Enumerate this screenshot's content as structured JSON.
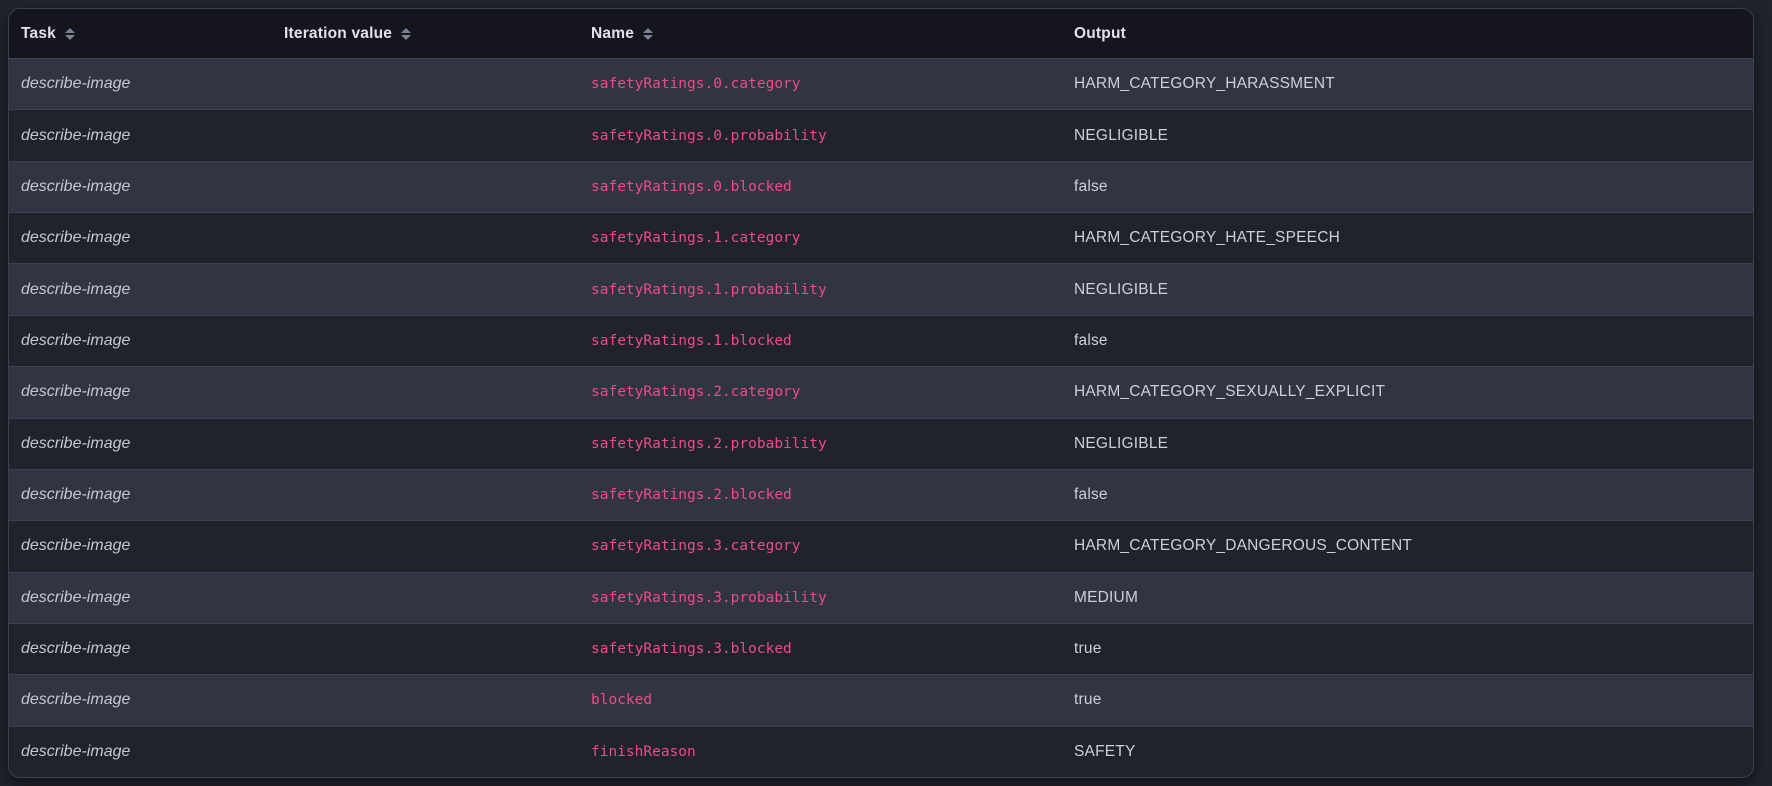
{
  "colors": {
    "page_background": "#21232b",
    "card_border": "#3d414f",
    "header_background": "#15161d",
    "row_light": "#313442",
    "row_dark": "#20222c",
    "row_separator": "#3e4250",
    "header_text": "#e3e2ea",
    "task_text": "#c4c7d3",
    "name_accent": "#ee4b87",
    "output_text": "#cdd0d9",
    "sort_icon": "#7b8095"
  },
  "icons": {
    "sort": "double-triangle-up-down"
  },
  "table": {
    "header": {
      "task": "Task",
      "iteration_value": "Iteration value",
      "name": "Name",
      "output": "Output"
    },
    "rows": [
      {
        "task": "describe-image",
        "iteration_value": "",
        "name": "safetyRatings.0.category",
        "output": "HARM_CATEGORY_HARASSMENT"
      },
      {
        "task": "describe-image",
        "iteration_value": "",
        "name": "safetyRatings.0.probability",
        "output": "NEGLIGIBLE"
      },
      {
        "task": "describe-image",
        "iteration_value": "",
        "name": "safetyRatings.0.blocked",
        "output": "false"
      },
      {
        "task": "describe-image",
        "iteration_value": "",
        "name": "safetyRatings.1.category",
        "output": "HARM_CATEGORY_HATE_SPEECH"
      },
      {
        "task": "describe-image",
        "iteration_value": "",
        "name": "safetyRatings.1.probability",
        "output": "NEGLIGIBLE"
      },
      {
        "task": "describe-image",
        "iteration_value": "",
        "name": "safetyRatings.1.blocked",
        "output": "false"
      },
      {
        "task": "describe-image",
        "iteration_value": "",
        "name": "safetyRatings.2.category",
        "output": "HARM_CATEGORY_SEXUALLY_EXPLICIT"
      },
      {
        "task": "describe-image",
        "iteration_value": "",
        "name": "safetyRatings.2.probability",
        "output": "NEGLIGIBLE"
      },
      {
        "task": "describe-image",
        "iteration_value": "",
        "name": "safetyRatings.2.blocked",
        "output": "false"
      },
      {
        "task": "describe-image",
        "iteration_value": "",
        "name": "safetyRatings.3.category",
        "output": "HARM_CATEGORY_DANGEROUS_CONTENT"
      },
      {
        "task": "describe-image",
        "iteration_value": "",
        "name": "safetyRatings.3.probability",
        "output": "MEDIUM"
      },
      {
        "task": "describe-image",
        "iteration_value": "",
        "name": "safetyRatings.3.blocked",
        "output": "true"
      },
      {
        "task": "describe-image",
        "iteration_value": "",
        "name": "blocked",
        "output": "true"
      },
      {
        "task": "describe-image",
        "iteration_value": "",
        "name": "finishReason",
        "output": "SAFETY"
      }
    ]
  }
}
